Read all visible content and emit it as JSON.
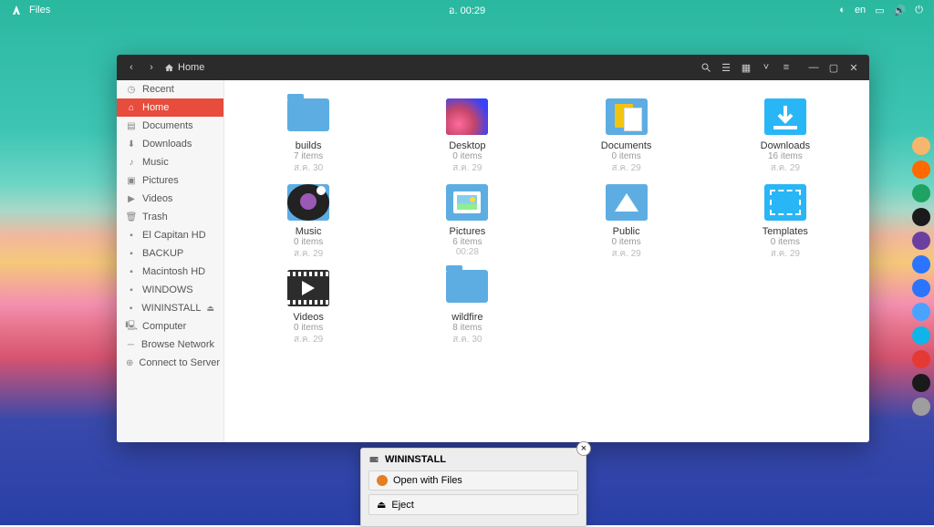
{
  "topbar": {
    "appname": "Files",
    "clock": "อ. 00:29",
    "lang": "en"
  },
  "window": {
    "location_label": "Home"
  },
  "sidebar": {
    "items": [
      {
        "icon": "clock",
        "label": "Recent"
      },
      {
        "icon": "home",
        "label": "Home",
        "active": true
      },
      {
        "icon": "doc",
        "label": "Documents"
      },
      {
        "icon": "down",
        "label": "Downloads"
      },
      {
        "icon": "music",
        "label": "Music"
      },
      {
        "icon": "pic",
        "label": "Pictures"
      },
      {
        "icon": "vid",
        "label": "Videos"
      },
      {
        "icon": "trash",
        "label": "Trash"
      },
      {
        "icon": "drive",
        "label": "El Capitan HD"
      },
      {
        "icon": "drive",
        "label": "BACKUP"
      },
      {
        "icon": "drive",
        "label": "Macintosh HD"
      },
      {
        "icon": "drive",
        "label": "WINDOWS"
      },
      {
        "icon": "drive",
        "label": "WININSTALL",
        "eject": true
      },
      {
        "icon": "comp",
        "label": "Computer"
      },
      {
        "icon": "net",
        "label": "Browse Network"
      },
      {
        "icon": "conn",
        "label": "Connect to Server"
      }
    ]
  },
  "folders": [
    {
      "name": "builds",
      "meta": "7 items",
      "date": "ส.ค. 30",
      "kind": "plain"
    },
    {
      "name": "Desktop",
      "meta": "0 items",
      "date": "ส.ค. 29",
      "kind": "desktop"
    },
    {
      "name": "Documents",
      "meta": "0 items",
      "date": "ส.ค. 29",
      "kind": "documents"
    },
    {
      "name": "Downloads",
      "meta": "16 items",
      "date": "ส.ค. 29",
      "kind": "downloads"
    },
    {
      "name": "Music",
      "meta": "0 items",
      "date": "ส.ค. 29",
      "kind": "music"
    },
    {
      "name": "Pictures",
      "meta": "6 items",
      "date": "00:28",
      "kind": "pictures"
    },
    {
      "name": "Public",
      "meta": "0 items",
      "date": "ส.ค. 29",
      "kind": "public"
    },
    {
      "name": "Templates",
      "meta": "0 items",
      "date": "ส.ค. 29",
      "kind": "templates"
    },
    {
      "name": "Videos",
      "meta": "0 items",
      "date": "ส.ค. 29",
      "kind": "videos"
    },
    {
      "name": "wildfire",
      "meta": "8 items",
      "date": "ส.ค. 30",
      "kind": "plain"
    }
  ],
  "notif": {
    "title": "WININSTALL",
    "open": "Open with Files",
    "eject": "Eject"
  },
  "dock_colors": [
    "#f8b66c",
    "#ff6a00",
    "#1ea362",
    "#1a1a1a",
    "#6b3fa0",
    "#2b74ff",
    "#2b74ff",
    "#4aa3ff",
    "#0fb5e8",
    "#e53935",
    "#1a1a1a",
    "#9e9e9e"
  ]
}
